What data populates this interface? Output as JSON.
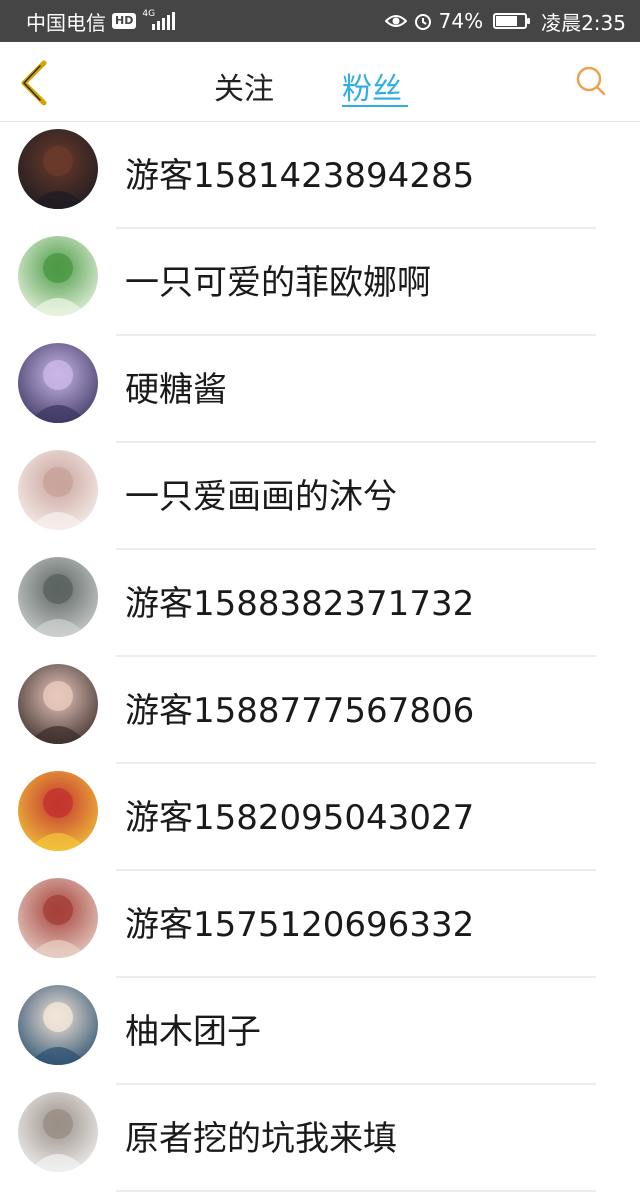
{
  "status_bar": {
    "carrier": "中国电信",
    "hd_badge": "HD",
    "network": "4G",
    "battery_percent": "74%",
    "battery_level": 0.74,
    "time": "凌晨2:35"
  },
  "header": {
    "tabs": [
      {
        "label": "关注",
        "active": false
      },
      {
        "label": "粉丝",
        "active": true
      }
    ],
    "accent_color": "#2eaee6",
    "back_icon": "chevron-left-icon",
    "back_icon_color": "#d6a300",
    "search_icon": "search-icon",
    "search_icon_color": "#f0a050"
  },
  "fans": [
    {
      "name": "游客1581423894285",
      "avatar_colors": [
        "#1b1b22",
        "#6b3a2a"
      ]
    },
    {
      "name": "一只可爱的菲欧娜啊",
      "avatar_colors": [
        "#eef6e6",
        "#4c9a45"
      ]
    },
    {
      "name": "硬糖酱",
      "avatar_colors": [
        "#3a3560",
        "#c9b6e8"
      ]
    },
    {
      "name": "一只爱画画的沐兮",
      "avatar_colors": [
        "#f8f1ee",
        "#c9a39c"
      ]
    },
    {
      "name": "游客1588382371732",
      "avatar_colors": [
        "#cfd3d2",
        "#5c6461"
      ]
    },
    {
      "name": "游客1588777567806",
      "avatar_colors": [
        "#3a2c2a",
        "#e8c8bc"
      ]
    },
    {
      "name": "游客1582095043027",
      "avatar_colors": [
        "#f4c63b",
        "#c2352f"
      ]
    },
    {
      "name": "游客1575120696332",
      "avatar_colors": [
        "#e9d3c8",
        "#a5413b"
      ]
    },
    {
      "name": "柚木团子",
      "avatar_colors": [
        "#2a4f6f",
        "#f2e4d8"
      ]
    },
    {
      "name": "原者挖的坑我来填",
      "avatar_colors": [
        "#f3f3f3",
        "#9a8f86"
      ]
    }
  ]
}
